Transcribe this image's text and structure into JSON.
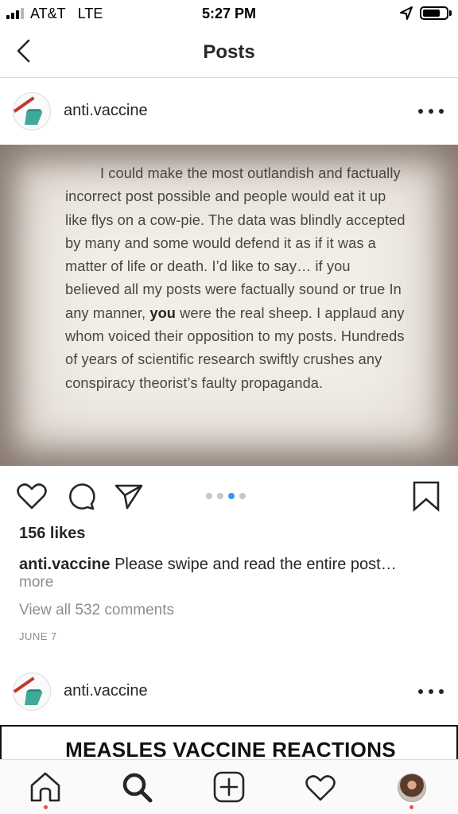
{
  "status_bar": {
    "carrier": "AT&T",
    "network": "LTE",
    "time": "5:27 PM",
    "battery_level": 0.75
  },
  "header": {
    "title": "Posts",
    "back_icon": "chevron-left-icon"
  },
  "posts": [
    {
      "username": "anti.vaccine",
      "image_text": {
        "before_bold": "I could make the most outlandish and factually incorrect post possible and people would eat it up like flys on a cow-pie. The data was blindly accepted by many and some would defend it as if it was a matter of life or death. I’d like to say… if you believed all my posts were factually sound or true In any manner,",
        "bold": "you",
        "after_bold": "were the real sheep. I applaud any whom voiced their opposition to my posts. Hundreds of years of scientific research swiftly crushes any conspiracy theorist’s faulty propaganda."
      },
      "carousel": {
        "count": 4,
        "active_index": 2
      },
      "likes": "156 likes",
      "caption_user": "anti.vaccine",
      "caption_text": "Please swipe and read the entire post…",
      "more_label": "more",
      "comments_label": "View all 532 comments",
      "date": "JUNE 7"
    },
    {
      "username": "anti.vaccine",
      "image_title": "MEASLES VACCINE REACTIONS"
    }
  ],
  "tab_bar": {
    "items": [
      "home-icon",
      "search-icon",
      "new-post-icon",
      "activity-heart-icon",
      "profile-avatar"
    ],
    "active": "search-icon"
  },
  "colors": {
    "accent_blue": "#3897f0",
    "notification_red": "#ed4956",
    "text_primary": "#262626",
    "text_secondary": "#8e8e8e"
  }
}
